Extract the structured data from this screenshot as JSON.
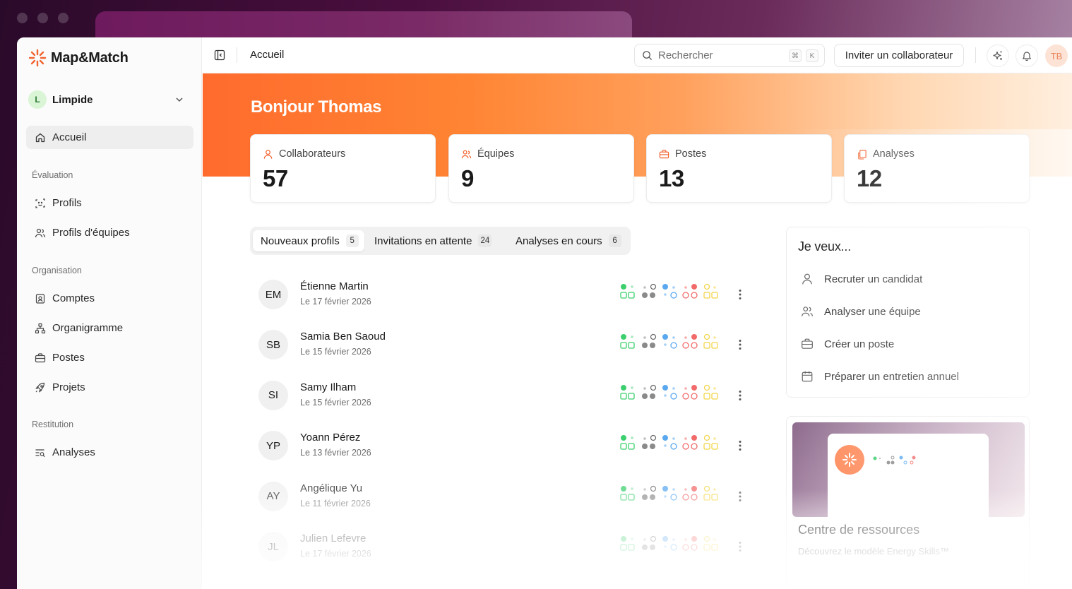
{
  "app": {
    "brand": "Map&Match",
    "workspace": {
      "initial": "L",
      "name": "Limpide"
    }
  },
  "sidebar": {
    "home": {
      "label": "Accueil",
      "icon": "home-icon"
    },
    "sections": [
      {
        "title": "Évaluation",
        "items": [
          {
            "label": "Profils",
            "icon": "scan-face-icon"
          },
          {
            "label": "Profils d'équipes",
            "icon": "users-icon"
          }
        ]
      },
      {
        "title": "Organisation",
        "items": [
          {
            "label": "Comptes",
            "icon": "contact-card-icon"
          },
          {
            "label": "Organigramme",
            "icon": "org-chart-icon"
          },
          {
            "label": "Postes",
            "icon": "briefcase-icon"
          },
          {
            "label": "Projets",
            "icon": "rocket-icon"
          }
        ]
      },
      {
        "title": "Restitution",
        "items": [
          {
            "label": "Analyses",
            "icon": "list-search-icon"
          }
        ]
      }
    ]
  },
  "header": {
    "breadcrumb": "Accueil",
    "search": {
      "placeholder": "Rechercher",
      "shortcut_mod": "⌘",
      "shortcut_key": "K"
    },
    "invite_label": "Inviter un collaborateur",
    "user_initials": "TB"
  },
  "hero": {
    "greeting": "Bonjour Thomas",
    "stats": [
      {
        "label": "Collaborateurs",
        "value": "57",
        "icon": "user-icon"
      },
      {
        "label": "Équipes",
        "value": "9",
        "icon": "users-icon"
      },
      {
        "label": "Postes",
        "value": "13",
        "icon": "briefcase-icon"
      },
      {
        "label": "Analyses",
        "value": "12",
        "icon": "copy-icon"
      }
    ]
  },
  "tabs": [
    {
      "label": "Nouveaux profils",
      "count": "5",
      "active": true
    },
    {
      "label": "Invitations en attente",
      "count": "24",
      "active": false
    },
    {
      "label": "Analyses en cours",
      "count": "6",
      "active": false
    }
  ],
  "profiles": [
    {
      "initials": "EM",
      "name": "Étienne Martin",
      "date": "Le 17 février 2026"
    },
    {
      "initials": "SB",
      "name": "Samia Ben Saoud",
      "date": "Le 15 février 2026"
    },
    {
      "initials": "SI",
      "name": "Samy Ilham",
      "date": "Le 15 février 2026"
    },
    {
      "initials": "YP",
      "name": "Yoann Pérez",
      "date": "Le 13 février 2026"
    },
    {
      "initials": "AY",
      "name": "Angélique Yu",
      "date": "Le 11 février 2026"
    },
    {
      "initials": "JL",
      "name": "Julien Lefevre",
      "date": "Le 17 février 2026"
    }
  ],
  "quick_actions": {
    "title": "Je veux...",
    "items": [
      {
        "label": "Recruter un candidat",
        "icon": "user-icon"
      },
      {
        "label": "Analyser une équipe",
        "icon": "users-icon"
      },
      {
        "label": "Créer un poste",
        "icon": "briefcase-icon"
      },
      {
        "label": "Préparer un entretien annuel",
        "icon": "calendar-icon"
      }
    ]
  },
  "resources": {
    "title": "Centre de ressources",
    "subtitle": "Découvrez le modèle Energy Skills™"
  },
  "colors": {
    "brand_orange": "#ff6b2d",
    "energy_green": "#3ccf6e",
    "energy_gray": "#8a8a8a",
    "energy_blue": "#5aa8f0",
    "energy_red": "#f26a6a",
    "energy_yellow": "#f2d54a"
  }
}
